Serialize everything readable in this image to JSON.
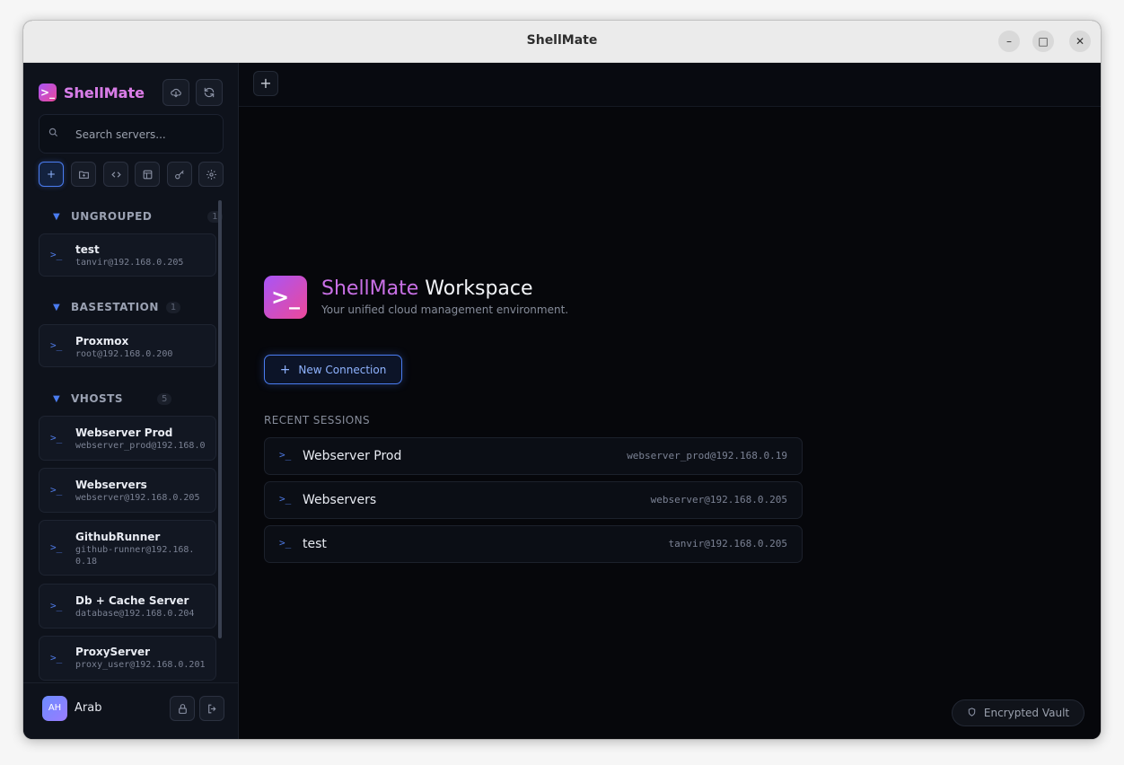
{
  "window": {
    "title": "ShellMate",
    "controls": {
      "minimize": "–",
      "maximize": "□",
      "close": "✕"
    }
  },
  "sidebar": {
    "brand": {
      "logo_glyph": ">_",
      "name": "ShellMate"
    },
    "header_buttons": {
      "cloud_icon": "cloud-download-icon",
      "refresh_icon": "refresh-icon"
    },
    "search": {
      "placeholder": "Search servers...",
      "value": ""
    },
    "toolbar": [
      {
        "icon": "plus-icon",
        "glyph": "+",
        "active": true
      },
      {
        "icon": "folder-plus-icon",
        "glyph": "⊞"
      },
      {
        "icon": "code-icon",
        "glyph": "<>"
      },
      {
        "icon": "layout-icon",
        "glyph": "▣"
      },
      {
        "icon": "key-icon",
        "glyph": "⚷"
      },
      {
        "icon": "gear-icon",
        "glyph": "⚙"
      }
    ],
    "groups": [
      {
        "name": "UNGROUPED",
        "count": "1",
        "servers": [
          {
            "name": "test",
            "host": "tanvir@192.168.0.205"
          }
        ]
      },
      {
        "name": "BASESTATION",
        "count": "1",
        "servers": [
          {
            "name": "Proxmox",
            "host": "root@192.168.0.200"
          }
        ]
      },
      {
        "name": "VHOSTS",
        "count": "5",
        "servers": [
          {
            "name": "Webserver Prod",
            "host": "webserver_prod@192.168.0"
          },
          {
            "name": "Webservers",
            "host": "webserver@192.168.0.205"
          },
          {
            "name": "GithubRunner",
            "host": "github-runner@192.168.0.18"
          },
          {
            "name": "Db + Cache Server",
            "host": "database@192.168.0.204"
          },
          {
            "name": "ProxyServer",
            "host": "proxy_user@192.168.0.201"
          }
        ]
      }
    ],
    "user": {
      "initials": "AH",
      "name": "Arab"
    }
  },
  "main": {
    "tabbar": {
      "add_label": "+"
    },
    "hero": {
      "logo_glyph": ">_",
      "title_brand": "ShellMate",
      "title_rest": " Workspace",
      "subtitle": "Your unified cloud management environment."
    },
    "new_connection": {
      "icon": "+",
      "label": "New Connection"
    },
    "recent": {
      "heading": "RECENT SESSIONS",
      "sessions": [
        {
          "name": "Webserver Prod",
          "host": "webserver_prod@192.168.0.19"
        },
        {
          "name": "Webservers",
          "host": "webserver@192.168.0.205"
        },
        {
          "name": "test",
          "host": "tanvir@192.168.0.205"
        }
      ]
    },
    "vault": {
      "icon": "shield-icon",
      "label": "Encrypted Vault"
    }
  },
  "colors": {
    "accent": "#4a7cf0",
    "brand_from": "#a855f7",
    "brand_to": "#ec4899",
    "background": "#06070b",
    "sidebar": "#0e121b"
  }
}
